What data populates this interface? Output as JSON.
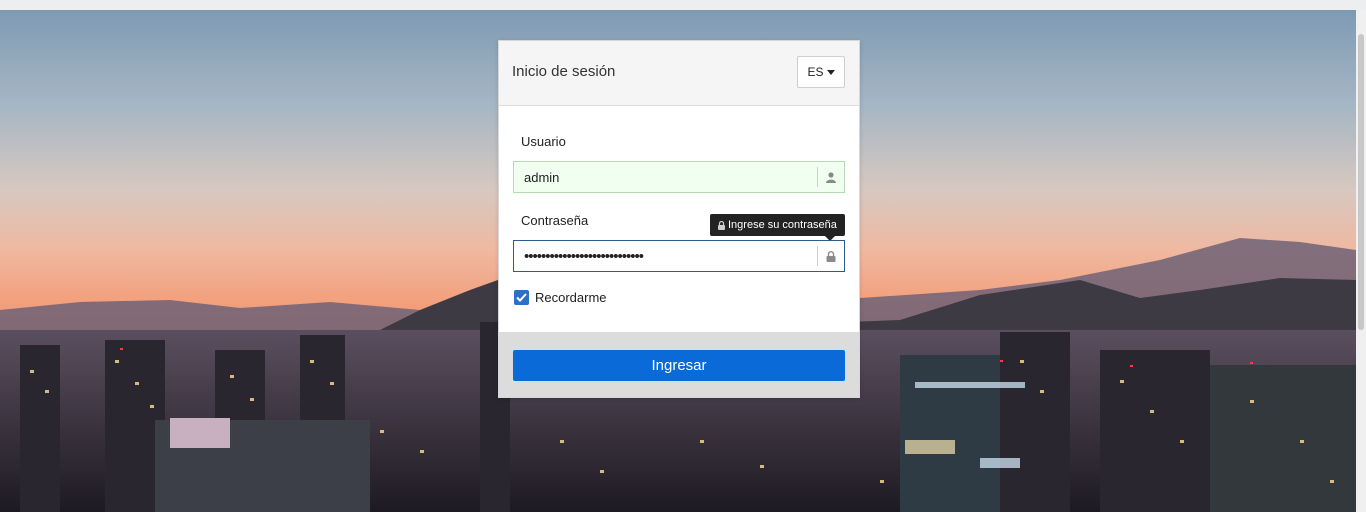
{
  "login": {
    "title": "Inicio de sesión",
    "language": "ES",
    "username_label": "Usuario",
    "username_value": "admin",
    "password_label": "Contraseña",
    "password_value": "••••••••••••••••••••••••••••",
    "password_tooltip": "Ingrese su contraseña",
    "remember_label": "Recordarme",
    "remember_checked": true,
    "submit_label": "Ingresar"
  },
  "colors": {
    "primary": "#0a6bd8",
    "checkbox": "#2c71c7",
    "username_field_bg": "#f0fff0",
    "tooltip_bg": "#222222"
  },
  "icons": [
    "chevron-down-icon",
    "user-icon",
    "lock-icon",
    "checkmark-icon"
  ]
}
